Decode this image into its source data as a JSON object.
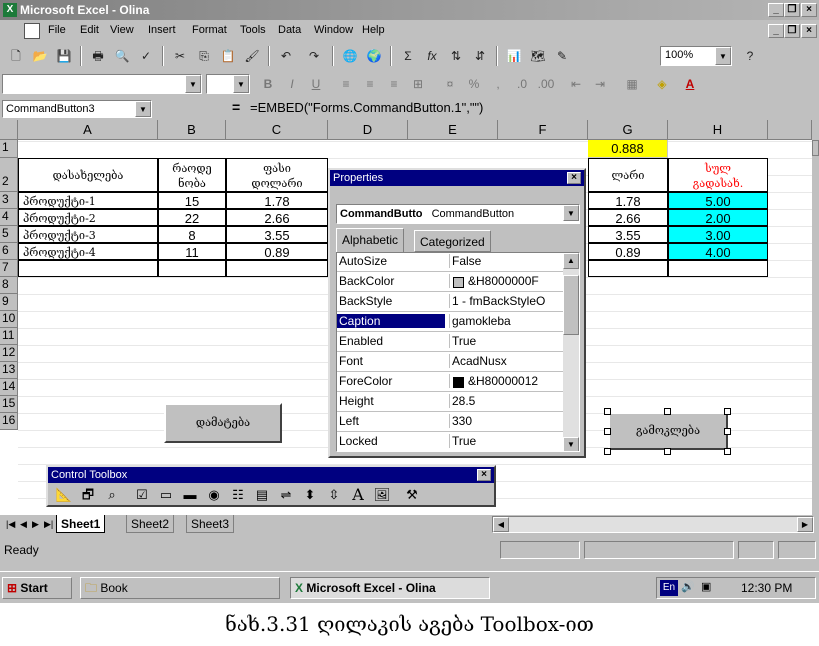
{
  "window": {
    "title": "Microsoft Excel - Olina"
  },
  "menu": {
    "items": [
      "File",
      "Edit",
      "View",
      "Insert",
      "Format",
      "Tools",
      "Data",
      "Window",
      "Help"
    ]
  },
  "toolbar": {
    "zoom": "100%",
    "font_sizes": [
      "B",
      "I",
      "U"
    ],
    "symbols": [
      "Σ",
      "fx",
      "%",
      ","
    ]
  },
  "formula_bar": {
    "name_box": "CommandButton3",
    "formula": "=EMBED(\"Forms.CommandButton.1\",\"\")"
  },
  "grid": {
    "columns": [
      "A",
      "B",
      "C",
      "D",
      "E",
      "F",
      "G",
      "H"
    ],
    "rows": [
      "1",
      "2",
      "3",
      "4",
      "5",
      "6",
      "7",
      "8",
      "9",
      "10",
      "11",
      "12",
      "13",
      "14",
      "15",
      "16"
    ],
    "g1_value": "0.888",
    "headers": {
      "a2": "დასახელება",
      "b2": "რაოდე\nნობა",
      "c2": "ფასი\nდოლარი",
      "g2": "ლარი",
      "h2": "სულ\nგადასახ."
    },
    "data_rows": [
      {
        "name": "პროდუქტი-1",
        "qty": "15",
        "price": "1.78",
        "g": "1.78",
        "h": "5.00"
      },
      {
        "name": "პროდუქტი-2",
        "qty": "22",
        "price": "2.66",
        "g": "2.66",
        "h": "2.00"
      },
      {
        "name": "პროდუქტი-3",
        "qty": "8",
        "price": "3.55",
        "g": "3.55",
        "h": "3.00"
      },
      {
        "name": "პროდუქტი-4",
        "qty": "11",
        "price": "0.89",
        "g": "0.89",
        "h": "4.00"
      }
    ],
    "highlight_color": "#00ffff",
    "g1_color": "#ffff00",
    "h2_text_color": "#ff0000"
  },
  "buttons": {
    "left_button": "დამატება",
    "right_button": "გამოკლება"
  },
  "properties": {
    "title": "Properties",
    "object_name": "CommandButto",
    "object_type": "CommandButton",
    "tabs": [
      "Alphabetic",
      "Categorized"
    ],
    "rows": [
      {
        "name": "AutoSize",
        "value": "False"
      },
      {
        "name": "BackColor",
        "value": "&H8000000F"
      },
      {
        "name": "BackStyle",
        "value": "1 - fmBackStyleO"
      },
      {
        "name": "Caption",
        "value": "gamokleba"
      },
      {
        "name": "Enabled",
        "value": "True"
      },
      {
        "name": "Font",
        "value": "AcadNusx"
      },
      {
        "name": "ForeColor",
        "value": "&H80000012"
      },
      {
        "name": "Height",
        "value": "28.5"
      },
      {
        "name": "Left",
        "value": "330"
      },
      {
        "name": "Locked",
        "value": "True"
      }
    ]
  },
  "control_toolbox": {
    "title": "Control Toolbox",
    "icons": [
      "design-mode",
      "properties",
      "view-code",
      "checkbox",
      "textbox",
      "command-button",
      "option-button",
      "listbox",
      "combobox",
      "toggle-button",
      "spin-button",
      "scrollbar",
      "label",
      "image",
      "more-controls"
    ]
  },
  "sheets": {
    "tabs": [
      "Sheet1",
      "Sheet2",
      "Sheet3"
    ],
    "active": "Sheet1"
  },
  "status": {
    "text": "Ready"
  },
  "taskbar": {
    "start": "Start",
    "book": "Book",
    "excel": "Microsoft Excel - Olina",
    "lang": "En",
    "clock": "12:30 PM"
  },
  "caption": "ნახ.3.31 ღილაკის აგება Toolbox-ით"
}
